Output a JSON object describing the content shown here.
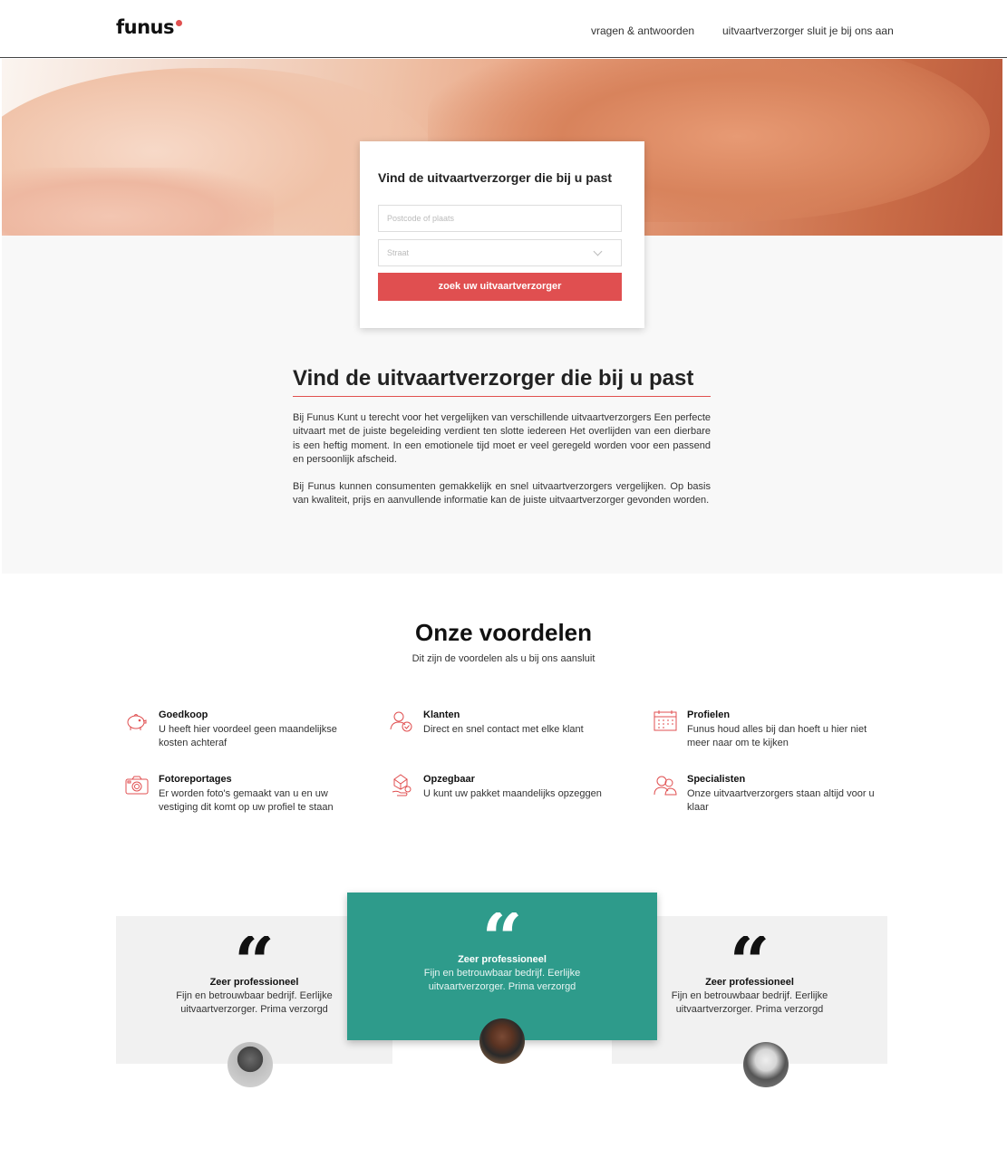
{
  "header": {
    "logo": "funus",
    "nav": [
      "vragen & antwoorden",
      "uitvaartverzorger sluit je bij ons aan"
    ]
  },
  "search": {
    "title": "Vind de uitvaartverzorger die bij u past",
    "postcode_placeholder": "Postcode of plaats",
    "straat_placeholder": "Straat",
    "button": "zoek uw uitvaartverzorger"
  },
  "intro": {
    "title": "Vind de uitvaartverzorger die bij u past",
    "p1": "Bij Funus Kunt u terecht voor het vergelijken van verschillende uitvaartverzorgers Een perfecte uitvaart met de juiste begeleiding verdient ten slotte iedereen Het overlijden van een dierbare is een heftig moment. In een emotionele tijd moet er veel geregeld worden voor een passend en persoonlijk afscheid.",
    "p2": "Bij Funus kunnen consumenten gemakkelijk en snel uitvaartverzorgers vergelijken. Op basis van kwaliteit, prijs en aanvullende informatie kan de juiste uitvaartverzorger gevonden worden."
  },
  "voordelen": {
    "title": "Onze voordelen",
    "subtitle": "Dit zijn de voordelen als u bij ons aansluit",
    "items": [
      {
        "icon": "piggy-bank-icon",
        "title": "Goedkoop",
        "text": "U heeft hier voordeel geen maandelijkse kosten achteraf"
      },
      {
        "icon": "users-check-icon",
        "title": "Klanten",
        "text": "Direct en snel contact met elke klant"
      },
      {
        "icon": "calendar-icon",
        "title": "Profielen",
        "text": "Funus houd alles bij dan hoeft u hier niet meer naar om te kijken"
      },
      {
        "icon": "camera-icon",
        "title": "Fotoreportages",
        "text": "Er worden foto's gemaakt van u en uw vestiging dit komt op uw profiel te staan"
      },
      {
        "icon": "box-hand-icon",
        "title": "Opzegbaar",
        "text": "U kunt uw pakket maandelijks opzeggen"
      },
      {
        "icon": "people-icon",
        "title": "Specialisten",
        "text": "Onze uitvaartverzorgers staan altijd voor u klaar"
      }
    ]
  },
  "testimonials": [
    {
      "quote_mark": "“",
      "title": "Zeer professioneel",
      "text": "Fijn en betrouwbaar bedrijf. Eerlijke uitvaartverzorger. Prima verzorgd"
    },
    {
      "quote_mark": "“",
      "title": "Zeer professioneel",
      "text": "Fijn en betrouwbaar bedrijf. Eerlijke uitvaartverzorger. Prima verzorgd"
    },
    {
      "quote_mark": "“",
      "title": "Zeer professioneel",
      "text": "Fijn en betrouwbaar bedrijf. Eerlijke uitvaartverzorger. Prima verzorgd"
    }
  ],
  "colors": {
    "accent": "#e04f50",
    "teal": "#2e9b8b",
    "grey_panel": "#f1f1f1"
  }
}
